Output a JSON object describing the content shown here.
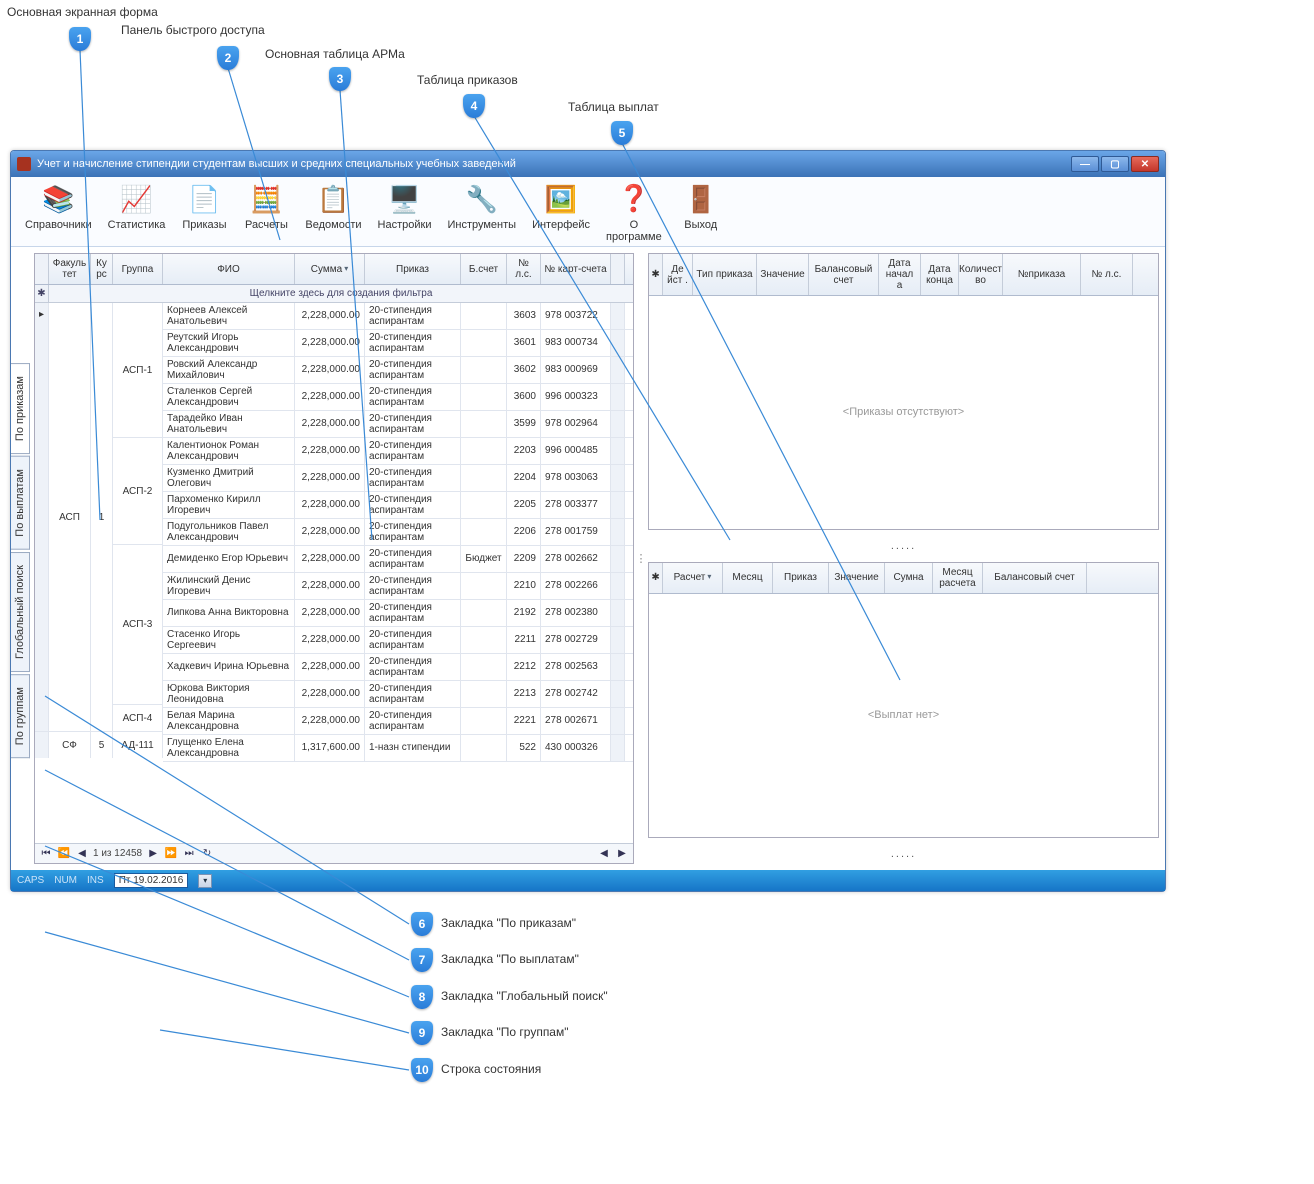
{
  "callouts": {
    "c1": "Основная экранная форма",
    "c2": "Панель быстрого доступа",
    "c3": "Основная таблица АРМа",
    "c4": "Таблица приказов",
    "c5": "Таблица выплат",
    "c6": "Закладка \"По приказам\"",
    "c7": "Закладка \"По выплатам\"",
    "c8": "Закладка \"Глобальный поиск\"",
    "c9": "Закладка \"По группам\"",
    "c10": "Строка состояния"
  },
  "window_title": "Учет и начисление стипендии студентам высших и средних специальных учебных заведений",
  "toolbar": [
    {
      "label": "Справочники",
      "icon": "📚"
    },
    {
      "label": "Статистика",
      "icon": "📈"
    },
    {
      "label": "Приказы",
      "icon": "📄"
    },
    {
      "label": "Расчеты",
      "icon": "🧮"
    },
    {
      "label": "Ведомости",
      "icon": "📋"
    },
    {
      "label": "Настройки",
      "icon": "🖥️"
    },
    {
      "label": "Инструменты",
      "icon": "🔧"
    },
    {
      "label": "Интерфейс",
      "icon": "🖼️"
    },
    {
      "label": "О\nпрограмме",
      "icon": "❓"
    },
    {
      "label": "Выход",
      "icon": "🚪"
    }
  ],
  "side_tabs": [
    "По приказам",
    "По выплатам",
    "Глобальный поиск",
    "По группам"
  ],
  "main_grid": {
    "columns": [
      "Факуль\nтет",
      "Ку\nрс",
      "Группа",
      "ФИО",
      "Сумма",
      "Приказ",
      "Б.счет",
      "№\nл.с.",
      "№\nкарт-счета"
    ],
    "filter_hint": "Щелкните здесь для создания фильтра",
    "faculty": "АСП",
    "kurs": "1",
    "bsc": "Бюджет",
    "faculty2": "СФ",
    "kurs2": "5",
    "groups": {
      "g1": "АСП-1",
      "g2": "АСП-2",
      "g3": "АСП-3",
      "g4": "АСП-4",
      "g5": "АД-111"
    },
    "rows": [
      {
        "fio": "Корнеев Алексей Анатольевич",
        "sum": "2,228,000.00",
        "ord": "20-стипендия аспирантам",
        "nls": "3603",
        "card": "978 003722"
      },
      {
        "fio": "Реутский Игорь Александрович",
        "sum": "2,228,000.00",
        "ord": "20-стипендия аспирантам",
        "nls": "3601",
        "card": "983 000734"
      },
      {
        "fio": "Ровский Александр Михайлович",
        "sum": "2,228,000.00",
        "ord": "20-стипендия аспирантам",
        "nls": "3602",
        "card": "983 000969"
      },
      {
        "fio": "Сталенков Сергей Александрович",
        "sum": "2,228,000.00",
        "ord": "20-стипендия аспирантам",
        "nls": "3600",
        "card": "996 000323"
      },
      {
        "fio": "Тарадейко Иван Анатольевич",
        "sum": "2,228,000.00",
        "ord": "20-стипендия аспирантам",
        "nls": "3599",
        "card": "978 002964"
      },
      {
        "fio": "Калентионок Роман Александрович",
        "sum": "2,228,000.00",
        "ord": "20-стипендия аспирантам",
        "nls": "2203",
        "card": "996 000485"
      },
      {
        "fio": "Кузменко Дмитрий Олегович",
        "sum": "2,228,000.00",
        "ord": "20-стипендия аспирантам",
        "nls": "2204",
        "card": "978 003063"
      },
      {
        "fio": "Пархоменко Кирилл Игоревич",
        "sum": "2,228,000.00",
        "ord": "20-стипендия аспирантам",
        "nls": "2205",
        "card": "278 003377"
      },
      {
        "fio": "Подугольников Павел Александрович",
        "sum": "2,228,000.00",
        "ord": "20-стипендия аспирантам",
        "nls": "2206",
        "card": "278 001759"
      },
      {
        "fio": "Демиденко Егор Юрьевич",
        "sum": "2,228,000.00",
        "ord": "20-стипендия аспирантам",
        "nls": "2209",
        "card": "278 002662"
      },
      {
        "fio": "Жилинский Денис Игоревич",
        "sum": "2,228,000.00",
        "ord": "20-стипендия аспирантам",
        "nls": "2210",
        "card": "278 002266"
      },
      {
        "fio": "Липкова Анна Викторовна",
        "sum": "2,228,000.00",
        "ord": "20-стипендия аспирантам",
        "nls": "2192",
        "card": "278 002380"
      },
      {
        "fio": "Стасенко Игорь Сергеевич",
        "sum": "2,228,000.00",
        "ord": "20-стипендия аспирантам",
        "nls": "2211",
        "card": "278 002729"
      },
      {
        "fio": "Хадкевич Ирина Юрьевна",
        "sum": "2,228,000.00",
        "ord": "20-стипендия аспирантам",
        "nls": "2212",
        "card": "278 002563"
      },
      {
        "fio": "Юркова Виктория Леонидовна",
        "sum": "2,228,000.00",
        "ord": "20-стипендия аспирантам",
        "nls": "2213",
        "card": "278 002742"
      },
      {
        "fio": "Белая Марина Александровна",
        "sum": "2,228,000.00",
        "ord": "20-стипендия аспирантам",
        "nls": "2221",
        "card": "278 002671"
      },
      {
        "fio": "Глущенко Елена Александровна",
        "sum": "1,317,600.00",
        "ord": "1-назн стипендии",
        "nls": "522",
        "card": "430 000326"
      }
    ],
    "nav": "1 из 12458"
  },
  "order_grid": {
    "columns": [
      "Де\nйст\n.",
      "Тип приказа",
      "Значение",
      "Балансовый\nсчет",
      "Дата\nначал\nа",
      "Дата\nконца",
      "Количест\nво",
      "№приказа",
      "№ л.с."
    ],
    "placeholder": "<Приказы отсутствуют>"
  },
  "dots": ".....",
  "pay_grid": {
    "columns": [
      "Расчет",
      "Месяц",
      "Приказ",
      "Значение",
      "Сумна",
      "Месяц\nрасчета",
      "Балансовый счет"
    ],
    "placeholder": "<Выплат нет>"
  },
  "status": {
    "caps": "CAPS",
    "num": "NUM",
    "ins": "INS",
    "date": "Пт 19.02.2016"
  }
}
